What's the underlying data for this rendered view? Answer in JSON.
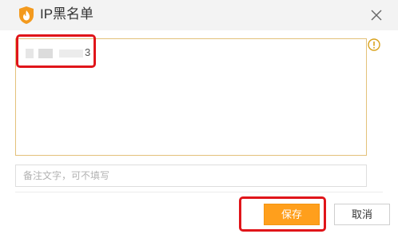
{
  "window": {
    "title": "IP黑名单",
    "app_icon": "orange-flame-shield-icon",
    "close_icon": "close-icon"
  },
  "ip_list": {
    "visible_suffix": "3",
    "warning_icon": "info-circle-icon"
  },
  "note": {
    "placeholder": "备注文字，可不填写",
    "value": ""
  },
  "buttons": {
    "save_label": "保存",
    "cancel_label": "取消"
  },
  "colors": {
    "save_bg": "#ff9f1c",
    "textarea_border": "#e3c17a",
    "highlight": "#e0151a",
    "warning": "#d9a21b"
  }
}
